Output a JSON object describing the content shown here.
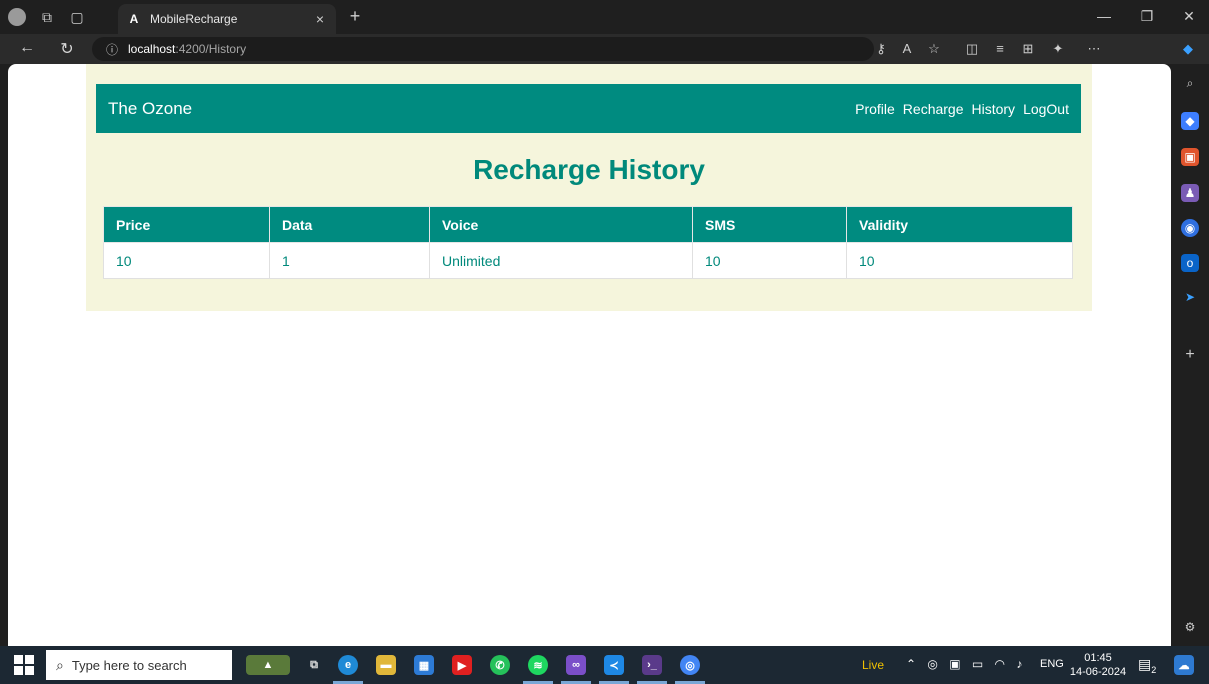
{
  "browser": {
    "tab_title": "MobileRecharge",
    "tab_favicon": "A",
    "tab_close": "×",
    "new_tab": "+",
    "url_host": "localhost",
    "url_path": ":4200/History"
  },
  "app": {
    "brand": "The Ozone",
    "nav_links": [
      "Profile",
      "Recharge",
      "History",
      "LogOut"
    ],
    "heading": "Recharge History",
    "table": {
      "headers": [
        "Price",
        "Data",
        "Voice",
        "SMS",
        "Validity"
      ],
      "rows": [
        [
          "10",
          "1",
          "Unlimited",
          "10",
          "10"
        ]
      ]
    }
  },
  "taskbar": {
    "search_placeholder": "Type here to search",
    "live_label": "Live",
    "language": "ENG",
    "time": "01:45",
    "date": "14-06-2024",
    "notification_count": "2"
  },
  "colors": {
    "accent": "#008b80",
    "page_bg": "#f5f5dc",
    "heading": "#00897b"
  }
}
